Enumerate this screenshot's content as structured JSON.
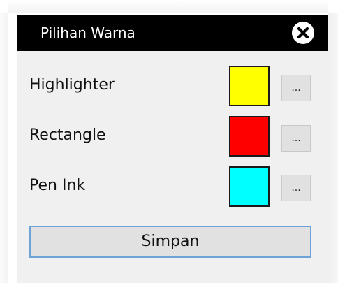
{
  "window": {
    "title": "Pilihan Warna",
    "close_icon": "close-x-circle-icon"
  },
  "rows": [
    {
      "label": "Highlighter",
      "color": "#ffff00",
      "button_label": "..."
    },
    {
      "label": "Rectangle",
      "color": "#ff0000",
      "button_label": "..."
    },
    {
      "label": "Pen Ink",
      "color": "#00ffff",
      "button_label": "..."
    }
  ],
  "save_button": {
    "label": "Simpan"
  },
  "colors": {
    "titlebar": "#000000",
    "dialog_background": "#f0f0f0",
    "button_background": "#e1e1e1",
    "focus_border": "#6ea3d8"
  }
}
